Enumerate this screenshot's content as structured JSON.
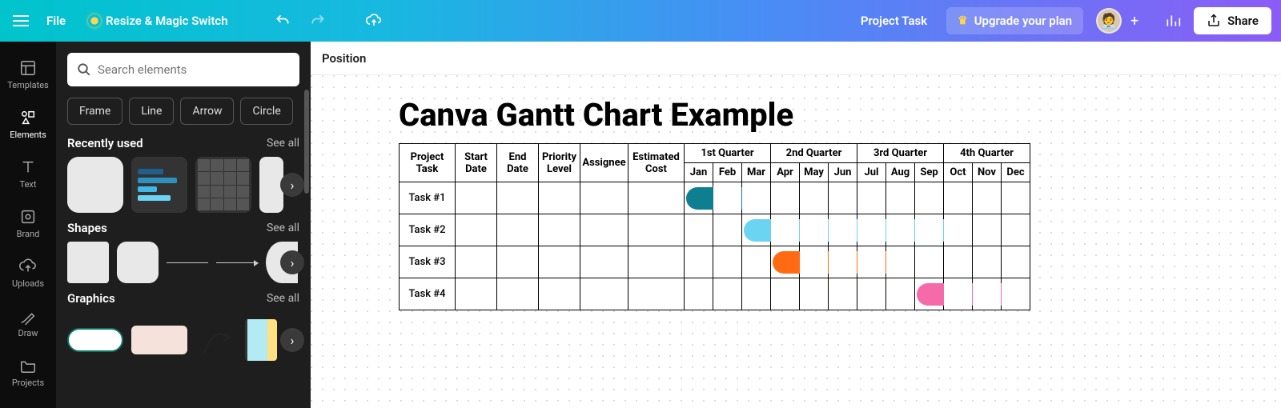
{
  "topbar": {
    "file": "File",
    "resize": "Resize & Magic Switch",
    "project_title": "Project Task",
    "upgrade": "Upgrade your plan",
    "share": "Share"
  },
  "rail": {
    "templates": "Templates",
    "elements": "Elements",
    "text": "Text",
    "brand": "Brand",
    "uploads": "Uploads",
    "draw": "Draw",
    "projects": "Projects"
  },
  "panel": {
    "search_placeholder": "Search elements",
    "chips": [
      "Frame",
      "Line",
      "Arrow",
      "Circle"
    ],
    "sections": {
      "recent": {
        "title": "Recently used",
        "see_all": "See all"
      },
      "shapes": {
        "title": "Shapes",
        "see_all": "See all"
      },
      "graphics": {
        "title": "Graphics",
        "see_all": "See all"
      }
    }
  },
  "toolbar2": {
    "position": "Position"
  },
  "document": {
    "title": "Canva Gantt Chart Example",
    "columns": {
      "task": "Project Task",
      "start": "Start Date",
      "end": "End Date",
      "priority": "Priority Level",
      "assignee": "Assignee",
      "cost": "Estimated Cost"
    },
    "quarters": [
      "1st Quarter",
      "2nd Quarter",
      "3rd Quarter",
      "4th Quarter"
    ],
    "months": [
      "Jan",
      "Feb",
      "Mar",
      "Apr",
      "May",
      "Jun",
      "Jul",
      "Aug",
      "Sep",
      "Oct",
      "Nov",
      "Dec"
    ],
    "tasks": [
      "Task #1",
      "Task #2",
      "Task #3",
      "Task #4"
    ]
  },
  "chart_data": {
    "type": "gantt",
    "title": "Canva Gantt Chart Example",
    "x_categories": [
      "Jan",
      "Feb",
      "Mar",
      "Apr",
      "May",
      "Jun",
      "Jul",
      "Aug",
      "Sep",
      "Oct",
      "Nov",
      "Dec"
    ],
    "quarters": [
      "1st Quarter",
      "2nd Quarter",
      "3rd Quarter",
      "4th Quarter"
    ],
    "series": [
      {
        "name": "Task #1",
        "start": "Jan",
        "end": "Mar",
        "color": "#0e7f91"
      },
      {
        "name": "Task #2",
        "start": "Mar",
        "end": "Oct",
        "color": "#6ad4f2"
      },
      {
        "name": "Task #3",
        "start": "Apr",
        "end": "Aug",
        "color": "#ff6a13"
      },
      {
        "name": "Task #4",
        "start": "Sep",
        "end": "Dec",
        "color": "#f56aa9"
      }
    ],
    "columns": [
      "Project Task",
      "Start Date",
      "End Date",
      "Priority Level",
      "Assignee",
      "Estimated Cost"
    ]
  },
  "colors": {
    "bar1": "#0e7f91",
    "bar2": "#6ad4f2",
    "bar3": "#ff6a13",
    "bar4": "#f56aa9"
  }
}
